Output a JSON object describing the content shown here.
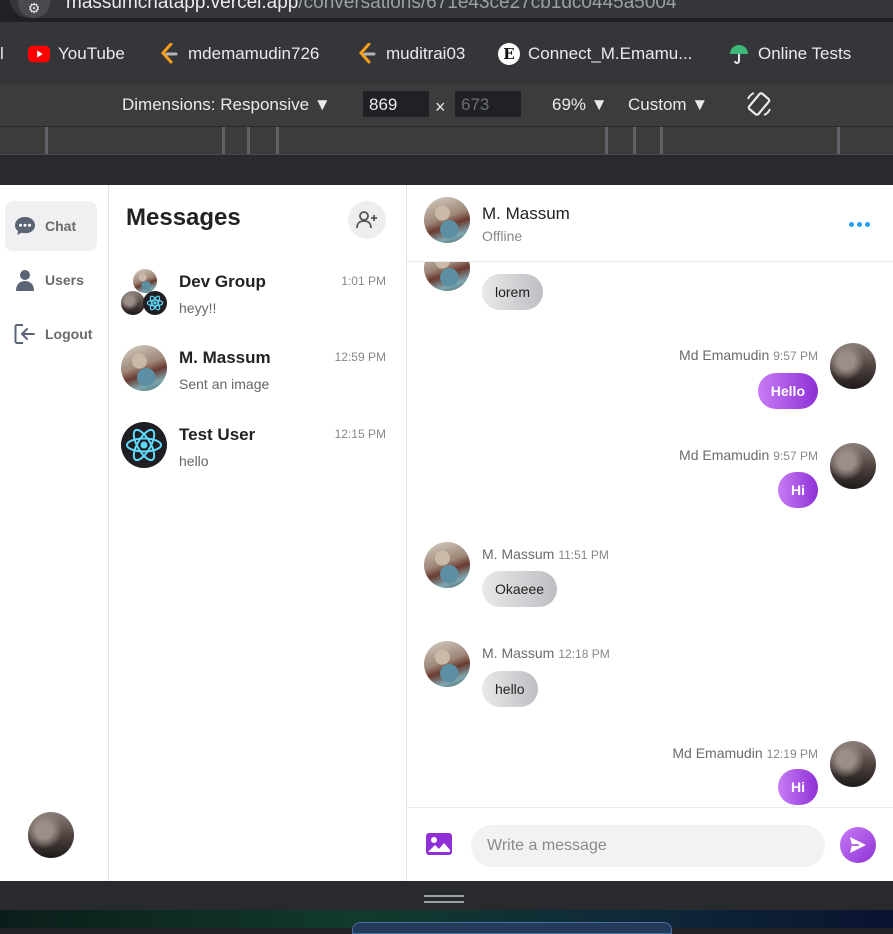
{
  "browser": {
    "url_host": "massumchatapp.vercel.app",
    "url_path": "/conversations/671e43ce27cb1dc0445a5004",
    "bookmarks": [
      {
        "label": "YouTube",
        "icon": "youtube-icon"
      },
      {
        "label": "mdemamudin726",
        "icon": "leetcode-icon"
      },
      {
        "label": "muditrai03",
        "icon": "leetcode-icon"
      },
      {
        "label": "Connect_M.Emamu...",
        "icon": "e-logo-icon"
      },
      {
        "label": "Online Tests",
        "icon": "umbrella-icon"
      }
    ],
    "bookmark_prefix": "l"
  },
  "devtools": {
    "dimensions_label": "Dimensions: Responsive",
    "width": "869",
    "height": "673",
    "times": "×",
    "zoom": "69%",
    "throttle": "Custom"
  },
  "sidenav": {
    "items": [
      {
        "label": "Chat",
        "icon": "chat-bubble-icon",
        "active": true
      },
      {
        "label": "Users",
        "icon": "user-icon",
        "active": false
      },
      {
        "label": "Logout",
        "icon": "logout-icon",
        "active": false
      }
    ]
  },
  "conversations": {
    "title": "Messages",
    "items": [
      {
        "name": "Dev Group",
        "time": "1:01 PM",
        "preview": "heyy!!"
      },
      {
        "name": "M. Massum",
        "time": "12:59 PM",
        "preview": "Sent an image"
      },
      {
        "name": "Test User",
        "time": "12:15 PM",
        "preview": "hello"
      }
    ]
  },
  "chat": {
    "contact_name": "M. Massum",
    "contact_status": "Offline",
    "messages": [
      {
        "direction": "in",
        "sender": "",
        "time": "",
        "text": "lorem"
      },
      {
        "direction": "out",
        "sender": "Md Emamudin",
        "time": "9:57 PM",
        "text": "Hello"
      },
      {
        "direction": "out",
        "sender": "Md Emamudin",
        "time": "9:57 PM",
        "text": "Hi"
      },
      {
        "direction": "in",
        "sender": "M. Massum",
        "time": "11:51 PM",
        "text": "Okaeee"
      },
      {
        "direction": "in",
        "sender": "M. Massum",
        "time": "12:18 PM",
        "text": "hello"
      },
      {
        "direction": "out",
        "sender": "Md Emamudin",
        "time": "12:19 PM",
        "text": "Hi"
      }
    ],
    "composer_placeholder": "Write a message"
  },
  "colors": {
    "accent_purple": "#8e30d6",
    "link_blue": "#22a3ee",
    "youtube_red": "#ff0000"
  }
}
